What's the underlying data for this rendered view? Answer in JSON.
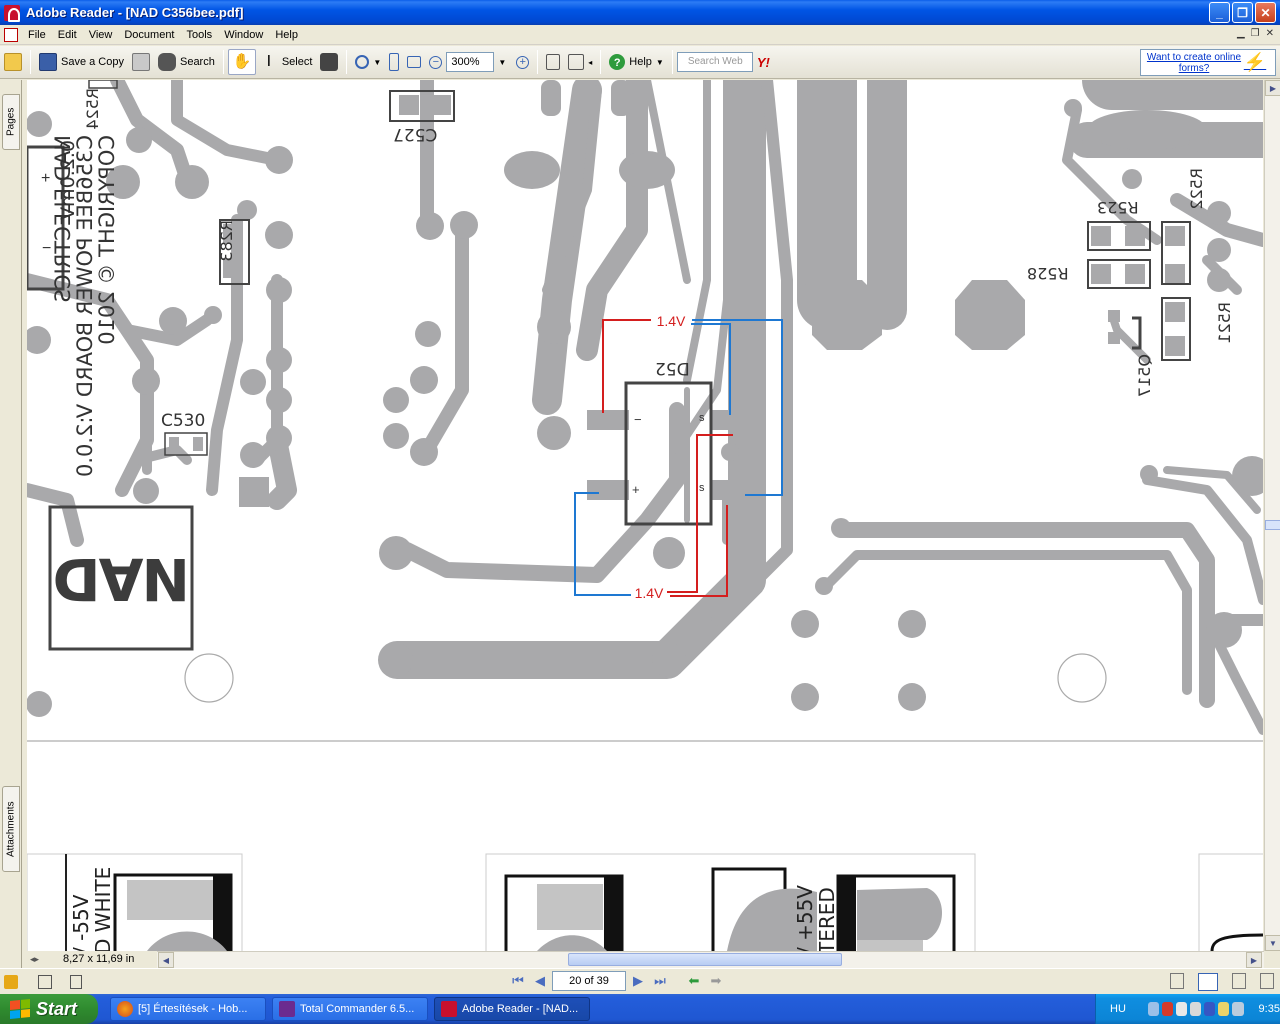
{
  "window": {
    "title": "Adobe Reader - [NAD C356bee.pdf]"
  },
  "menu": {
    "items": [
      "File",
      "Edit",
      "View",
      "Document",
      "Tools",
      "Window",
      "Help"
    ]
  },
  "toolbar": {
    "save_copy_label": "Save a Copy",
    "search_label": "Search",
    "select_label": "Select",
    "zoom_value": "300%",
    "help_label": "Help",
    "search_web_placeholder": "Search Web",
    "forms_ad": "Want to create online forms?"
  },
  "navpanel": {
    "pages_tab": "Pages",
    "attachments_tab": "Attachments"
  },
  "document": {
    "component_labels": [
      "C527",
      "R524",
      "R283",
      "C530",
      "D52",
      "R523",
      "R522",
      "R528",
      "R521",
      "Q517"
    ],
    "silk_lines": [
      "NAD ELECTRICS",
      "C356BEE POWER BOARD V:2.0.0",
      "COPYRIGHT © 2010"
    ],
    "silk_short": "0.2.0mV",
    "polarity_plus": "+",
    "polarity_minus": "−",
    "nad_logo": "NAD",
    "voltage_annotations": [
      "1.4V",
      "1.4V"
    ],
    "lower_labels": [
      "/ -55V",
      "D WHITE",
      "/ +55V",
      "TERED"
    ],
    "diode_pins": [
      "s",
      "s",
      "−",
      "+"
    ]
  },
  "status": {
    "page_size": "8,27 x 11,69 in",
    "page_indicator": "20 of 39"
  },
  "taskbar": {
    "start_label": "Start",
    "tasks": [
      "[5] Értesítések - Hob...",
      "Total Commander 6.5...",
      "Adobe Reader - [NAD..."
    ],
    "language": "HU",
    "clock": "9:35"
  },
  "colors": {
    "copper": "#a9a9ab",
    "annotation_red": "#d41e1e",
    "annotation_blue": "#1e78d2"
  }
}
